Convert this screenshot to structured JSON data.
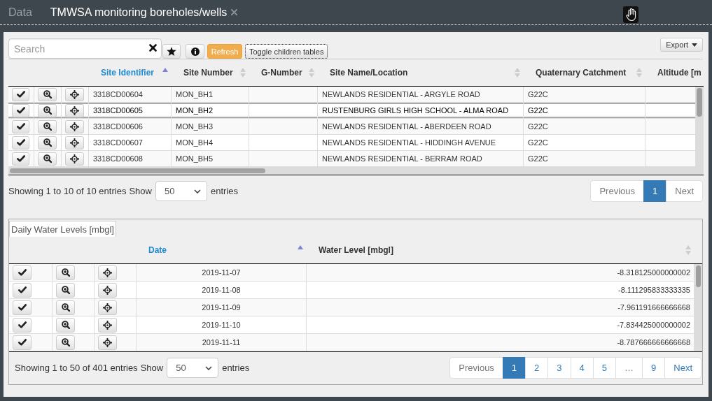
{
  "map_tabs": [
    {
      "label": "Data",
      "selected": false,
      "closable": false
    },
    {
      "label": "TMWSA monitoring boreholes/wells",
      "selected": true,
      "closable": true
    }
  ],
  "toolbar": {
    "search": {
      "placeholder": "Search"
    },
    "refresh": "Refresh",
    "toggle": {
      "label": "Toggle children tables",
      "focused": true
    },
    "export": "Export"
  },
  "main_table": {
    "columns": [
      {
        "label": "Site Identifier",
        "sorted": true
      },
      {
        "label": "Site Number",
        "sorted": false
      },
      {
        "label": "G-Number",
        "sorted": false
      },
      {
        "label": "Site Name/Location",
        "sorted": false
      },
      {
        "label": "Quaternary Catchment",
        "sorted": false
      },
      {
        "label": "Altitude [m"
      }
    ],
    "rows": [
      {
        "site_identifier": "3318CD00604",
        "site_number": "MON_BH1",
        "site_name_location": "NEWLANDS RESIDENTIAL - ARGYLE ROAD",
        "quaternary_catchment": "G22C",
        "selected": false
      },
      {
        "site_identifier": "3318CD00605",
        "site_number": "MON_BH2",
        "site_name_location": "RUSTENBURG GIRLS HIGH SCHOOL - ALMA ROAD",
        "quaternary_catchment": "G22C",
        "selected": true
      },
      {
        "site_identifier": "3318CD00606",
        "site_number": "MON_BH3",
        "site_name_location": "NEWLANDS RESIDENTIAL - ABERDEEN ROAD",
        "quaternary_catchment": "G22C",
        "selected": false
      },
      {
        "site_identifier": "3318CD00607",
        "site_number": "MON_BH4",
        "site_name_location": "NEWLANDS RESIDENTIAL - HIDDINGH AVENUE",
        "quaternary_catchment": "G22C",
        "selected": false
      },
      {
        "site_identifier": "3318CD00608",
        "site_number": "MON_BH5",
        "site_name_location": "NEWLANDS RESIDENTIAL - BERRAM ROAD",
        "quaternary_catchment": "G22C",
        "selected": false
      }
    ],
    "pagination": {
      "info": "Showing 1 to 10 of 10 entries",
      "show_label": "Show",
      "length": "50",
      "entries_label": "entries",
      "pages": [
        {
          "label": "Previous",
          "selected": false,
          "disabled": true
        },
        {
          "label": "1",
          "selected": true,
          "disabled": false
        },
        {
          "label": "Next",
          "selected": false,
          "disabled": true
        }
      ]
    }
  },
  "child_panel": {
    "tabs": [
      {
        "label": "Daily Water Levels [mbgl]",
        "selected": true
      }
    ],
    "table": {
      "columns": [
        {
          "label": "Date",
          "sorted": true
        },
        {
          "label": "Water Level [mbgl]",
          "sorted": false
        }
      ],
      "rows": [
        {
          "date": "2019-11-07",
          "water_level": "-8.318125000000002"
        },
        {
          "date": "2019-11-08",
          "water_level": "-8.111295833333335"
        },
        {
          "date": "2019-11-09",
          "water_level": "-7.961191666666668"
        },
        {
          "date": "2019-11-10",
          "water_level": "-7.834425000000002"
        },
        {
          "date": "2019-11-11",
          "water_level": "-8.787666666666668"
        }
      ],
      "pagination": {
        "info": "Showing 1 to 50 of 401 entries",
        "show_label": "Show",
        "length": "50",
        "entries_label": "entries",
        "pages": [
          {
            "label": "Previous",
            "selected": false,
            "disabled": true
          },
          {
            "label": "1",
            "selected": true,
            "disabled": false
          },
          {
            "label": "2",
            "selected": false,
            "disabled": false
          },
          {
            "label": "3",
            "selected": false,
            "disabled": false
          },
          {
            "label": "4",
            "selected": false,
            "disabled": false
          },
          {
            "label": "5",
            "selected": false,
            "disabled": false
          },
          {
            "label": "…",
            "selected": false,
            "disabled": true
          },
          {
            "label": "9",
            "selected": false,
            "disabled": false
          },
          {
            "label": "Next",
            "selected": false,
            "disabled": false
          }
        ]
      }
    }
  }
}
